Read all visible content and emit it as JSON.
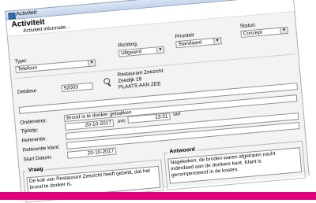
{
  "window": {
    "title": "Activiteit"
  },
  "header": {
    "title": "Activiteit",
    "subtitle": "Activiteit informatie..."
  },
  "fields": {
    "type": {
      "label": "Type:",
      "value": "Telefoon"
    },
    "richting": {
      "label": "Richting:",
      "value": "Uitgaand"
    },
    "prioriteit": {
      "label": "Prioriteit",
      "value": "Standaard"
    },
    "status": {
      "label": "Status:",
      "value": "Concept"
    },
    "debiteur": {
      "label": "Debiteur",
      "value": "92003",
      "address": [
        "Restaurant Zeezicht",
        "Zeedijk 18",
        "PLAATS AAN ZEE"
      ]
    },
    "onderwerp": {
      "label": "Onderwerp:",
      "value": "Brood is te donker gebakken"
    },
    "tijdstip": {
      "label": "Tijdstip:",
      "date": "20-10-2017",
      "om_label": "om:",
      "time": "13:31",
      "uur_label": "uur"
    },
    "referentie": {
      "label": "Referentie:",
      "value": ""
    },
    "referentie_klant": {
      "label": "Referentie klant:",
      "value": ""
    },
    "start_datum": {
      "label": "Start Datum:",
      "value": "20-10-2017"
    }
  },
  "vraag": {
    "title": "Vraag",
    "text": "De kok van Restaurant Zeezicht heeft gebeld, dat het brood te donker is."
  },
  "antwoord": {
    "title": "Antwoord",
    "text": "Nagekeken, de broden waren afgelopen nacht inderdaad aan de donkere kant. Klant is gecompenseerd in de kosten."
  },
  "colors": {
    "accent_bar": "#e3007b",
    "titlebar": "#c3d4ec"
  },
  "icons": {
    "lookup": "search-icon",
    "window_controls": [
      "minimize-icon",
      "maximize-icon",
      "close-icon"
    ]
  }
}
